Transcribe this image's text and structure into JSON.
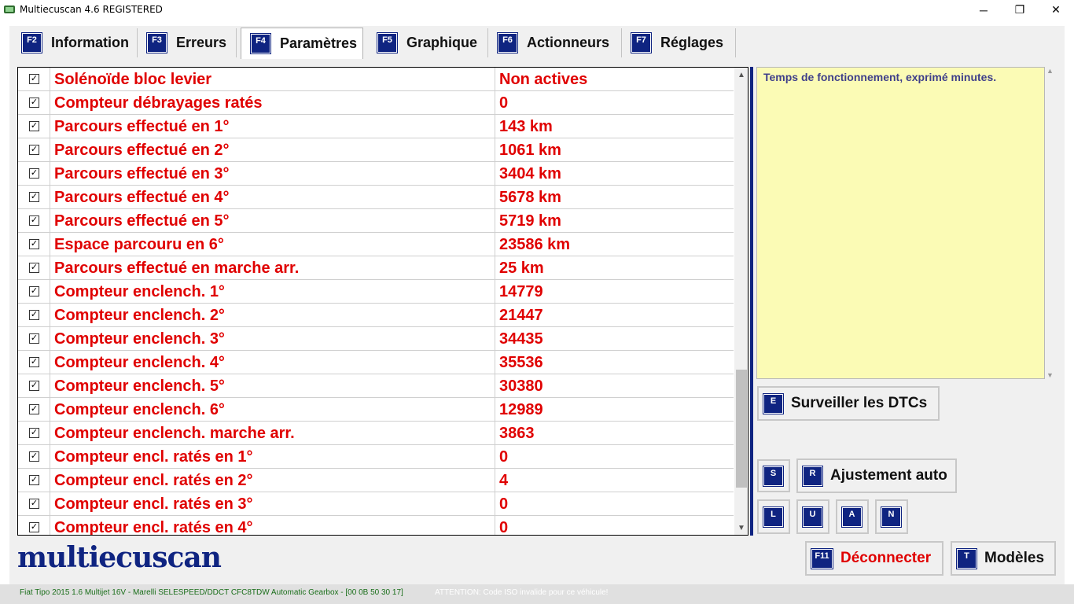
{
  "window": {
    "title": "Multiecuscan 4.6 REGISTERED",
    "minimize_glyph": "─",
    "maximize_glyph": "❐",
    "close_glyph": "✕"
  },
  "tabs": [
    {
      "key": "F2",
      "label": "Information"
    },
    {
      "key": "F3",
      "label": "Erreurs"
    },
    {
      "key": "F4",
      "label": "Paramètres"
    },
    {
      "key": "F5",
      "label": "Graphique"
    },
    {
      "key": "F6",
      "label": "Actionneurs"
    },
    {
      "key": "F7",
      "label": "Réglages"
    }
  ],
  "parameters": [
    {
      "checked": true,
      "name": "Solénoïde bloc levier",
      "value": "Non actives"
    },
    {
      "checked": true,
      "name": "Compteur débrayages ratés",
      "value": "0"
    },
    {
      "checked": true,
      "name": "Parcours effectué en 1°",
      "value": "143 km"
    },
    {
      "checked": true,
      "name": "Parcours effectué en 2°",
      "value": "1061 km"
    },
    {
      "checked": true,
      "name": "Parcours effectué en 3°",
      "value": "3404 km"
    },
    {
      "checked": true,
      "name": "Parcours effectué en 4°",
      "value": "5678 km"
    },
    {
      "checked": true,
      "name": "Parcours effectué en 5°",
      "value": "5719 km"
    },
    {
      "checked": true,
      "name": "Espace parcouru en 6°",
      "value": "23586 km"
    },
    {
      "checked": true,
      "name": "Parcours effectué en marche arr.",
      "value": "25 km"
    },
    {
      "checked": true,
      "name": "Compteur enclench. 1°",
      "value": "14779"
    },
    {
      "checked": true,
      "name": "Compteur enclench. 2°",
      "value": "21447"
    },
    {
      "checked": true,
      "name": "Compteur enclench. 3°",
      "value": "34435"
    },
    {
      "checked": true,
      "name": "Compteur enclench. 4°",
      "value": "35536"
    },
    {
      "checked": true,
      "name": "Compteur enclench. 5°",
      "value": "30380"
    },
    {
      "checked": true,
      "name": "Compteur enclench. 6°",
      "value": "12989"
    },
    {
      "checked": true,
      "name": "Compteur enclench. marche arr.",
      "value": "3863"
    },
    {
      "checked": true,
      "name": "Compteur encl. ratés en 1°",
      "value": "0"
    },
    {
      "checked": true,
      "name": "Compteur encl. ratés en 2°",
      "value": "4"
    },
    {
      "checked": true,
      "name": "Compteur encl. ratés en 3°",
      "value": "0"
    },
    {
      "checked": true,
      "name": "Compteur encl. ratés en 4°",
      "value": "0"
    }
  ],
  "checkbox_glyph": "✓",
  "scroll": {
    "up_glyph": "▲",
    "down_glyph": "▼"
  },
  "description": "Temps de fonctionnement, exprimé minutes.",
  "buttons": {
    "monitor_dtc": {
      "key": "E",
      "label": "Surveiller les DTCs"
    },
    "s": {
      "key": "S"
    },
    "auto_adjust": {
      "key": "R",
      "label": "Ajustement auto"
    },
    "l": {
      "key": "L"
    },
    "u": {
      "key": "U"
    },
    "a": {
      "key": "A"
    },
    "n": {
      "key": "N"
    },
    "disconnect": {
      "key": "F11",
      "label": "Déconnecter"
    },
    "models": {
      "key": "T",
      "label": "Modèles"
    }
  },
  "logo": "multiecuscan",
  "status": {
    "vehicle": "Fiat Tipo 2015 1.6 Multijet 16V - Marelli SELESPEED/DDCT CFC8TDW Automatic Gearbox - [00 0B 50 30 17]",
    "warning": "ATTENTION: Code ISO invalide pour ce véhicule!"
  },
  "colors": {
    "accent": "#0f2481",
    "param_text": "#e00000",
    "description_bg": "#fbfbb5",
    "status_vehicle": "#1a6e1a"
  }
}
